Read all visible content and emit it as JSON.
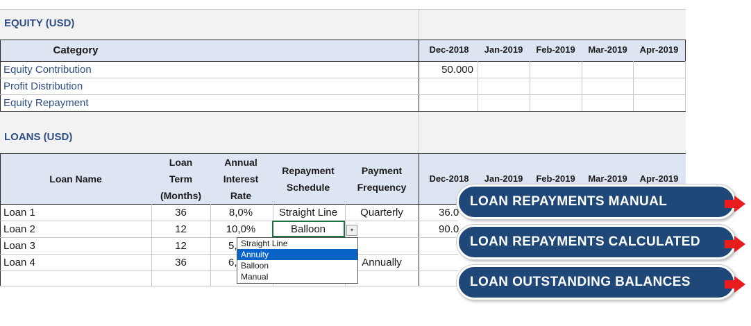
{
  "equity": {
    "title": "EQUITY (USD)",
    "category_header": "Category",
    "months": [
      "Dec-2018",
      "Jan-2019",
      "Feb-2019",
      "Mar-2019",
      "Apr-2019"
    ],
    "rows": [
      {
        "label": "Equity Contribution",
        "dec": "50.000"
      },
      {
        "label": "Profit Distribution",
        "dec": ""
      },
      {
        "label": "Equity Repayment",
        "dec": ""
      }
    ]
  },
  "loans": {
    "title": "LOANS (USD)",
    "headers": {
      "name": "Loan Name",
      "term": [
        "Loan",
        "Term",
        "(Months)"
      ],
      "rate": [
        "Annual",
        "Interest",
        "Rate"
      ],
      "schedule": [
        "Repayment",
        "Schedule"
      ],
      "frequency": [
        "Payment",
        "Frequency"
      ]
    },
    "months": [
      "Dec-2018",
      "Jan-2019",
      "Feb-2019",
      "Mar-2019",
      "Apr-2019"
    ],
    "rows": [
      {
        "name": "Loan 1",
        "term": "36",
        "rate": "8,0%",
        "schedule": "Straight Line",
        "frequency": "Quarterly",
        "dec": "36.0"
      },
      {
        "name": "Loan 2",
        "term": "12",
        "rate": "10,0%",
        "schedule": "Balloon",
        "frequency": "",
        "dec": "90.0"
      },
      {
        "name": "Loan 3",
        "term": "12",
        "rate": "5,",
        "schedule": "",
        "frequency": "",
        "dec": ""
      },
      {
        "name": "Loan 4",
        "term": "36",
        "rate": "6,",
        "schedule": "",
        "frequency": "Annually",
        "dec": ""
      }
    ]
  },
  "dropdown": {
    "options": [
      "Straight Line",
      "Annuity",
      "Balloon",
      "Manual"
    ],
    "highlighted": "Annuity",
    "button_glyph": "▾"
  },
  "nav_buttons": [
    {
      "label": "LOAN REPAYMENTS MANUAL"
    },
    {
      "label": "LOAN REPAYMENTS CALCULATED"
    },
    {
      "label": "LOAN OUTSTANDING BALANCES"
    }
  ],
  "colors": {
    "section_title": "#2f4f86",
    "header_fill": "#dde4f2",
    "button_fill": "#1f4878",
    "arrow": "#e81c1c",
    "dropdown_highlight": "#0a64c8"
  }
}
